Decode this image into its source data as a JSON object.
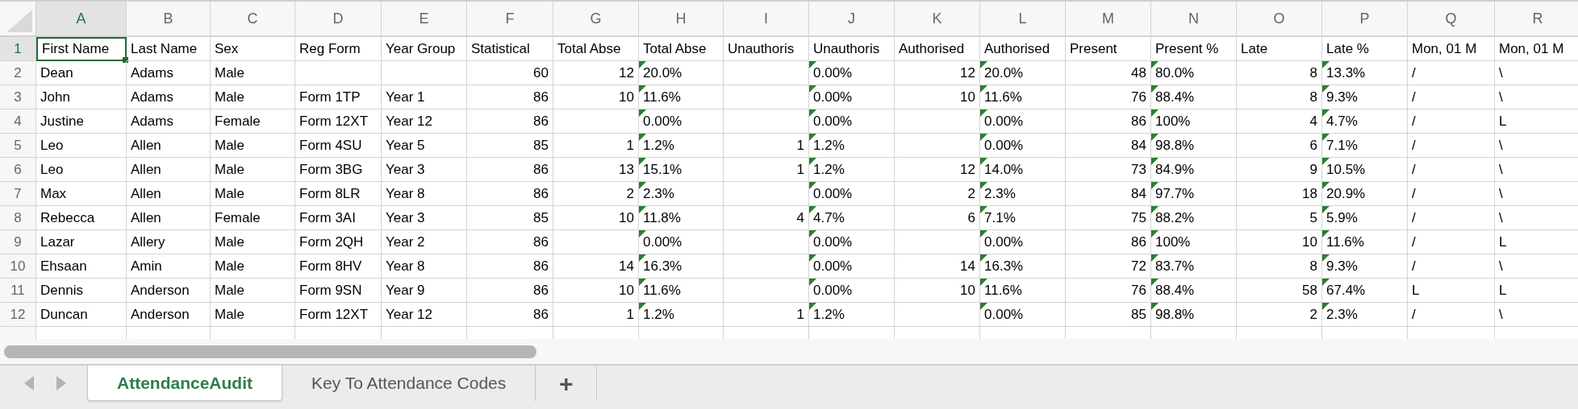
{
  "columns": [
    {
      "letter": "A",
      "kind": "text",
      "selected": true
    },
    {
      "letter": "B",
      "kind": "text",
      "selected": false
    },
    {
      "letter": "C",
      "kind": "text",
      "selected": false
    },
    {
      "letter": "D",
      "kind": "text",
      "selected": false
    },
    {
      "letter": "E",
      "kind": "text",
      "selected": false
    },
    {
      "letter": "F",
      "kind": "number",
      "selected": false
    },
    {
      "letter": "G",
      "kind": "number",
      "selected": false
    },
    {
      "letter": "H",
      "kind": "percent",
      "selected": false
    },
    {
      "letter": "I",
      "kind": "number",
      "selected": false
    },
    {
      "letter": "J",
      "kind": "percent",
      "selected": false
    },
    {
      "letter": "K",
      "kind": "number",
      "selected": false
    },
    {
      "letter": "L",
      "kind": "percent",
      "selected": false
    },
    {
      "letter": "M",
      "kind": "number",
      "selected": false
    },
    {
      "letter": "N",
      "kind": "percent",
      "selected": false
    },
    {
      "letter": "O",
      "kind": "number",
      "selected": false
    },
    {
      "letter": "P",
      "kind": "percent",
      "selected": false
    },
    {
      "letter": "Q",
      "kind": "text",
      "selected": false
    },
    {
      "letter": "R",
      "kind": "text",
      "selected": false
    }
  ],
  "rows": [
    {
      "number": "1",
      "kind": "header",
      "selected": true,
      "cells": [
        "First Name",
        "Last Name",
        "Sex",
        "Reg Form",
        "Year Group",
        "Statistical",
        "Total Abse",
        "Total Abse",
        "Unauthoris",
        "Unauthoris",
        "Authorised",
        "Authorised",
        "Present",
        "Present %",
        "Late",
        "Late %",
        "Mon, 01 M",
        "Mon, 01 M"
      ]
    },
    {
      "number": "2",
      "kind": "data",
      "selected": false,
      "cells": [
        "Dean",
        "Adams",
        "Male",
        null,
        null,
        "60",
        "12",
        "20.0%",
        null,
        "0.00%",
        "12",
        "20.0%",
        "48",
        "80.0%",
        "8",
        "13.3%",
        "/",
        "\\"
      ]
    },
    {
      "number": "3",
      "kind": "data",
      "selected": false,
      "cells": [
        "John",
        "Adams",
        "Male",
        "Form 1TP",
        "Year 1",
        "86",
        "10",
        "11.6%",
        null,
        "0.00%",
        "10",
        "11.6%",
        "76",
        "88.4%",
        "8",
        "9.3%",
        "/",
        "\\"
      ]
    },
    {
      "number": "4",
      "kind": "data",
      "selected": false,
      "cells": [
        "Justine",
        "Adams",
        "Female",
        "Form 12XT",
        "Year 12",
        "86",
        null,
        "0.00%",
        null,
        "0.00%",
        null,
        "0.00%",
        "86",
        "100%",
        "4",
        "4.7%",
        "/",
        "L"
      ]
    },
    {
      "number": "5",
      "kind": "data",
      "selected": false,
      "cells": [
        "Leo",
        "Allen",
        "Male",
        "Form 4SU",
        "Year 5",
        "85",
        "1",
        "1.2%",
        "1",
        "1.2%",
        null,
        "0.00%",
        "84",
        "98.8%",
        "6",
        "7.1%",
        "/",
        "\\"
      ]
    },
    {
      "number": "6",
      "kind": "data",
      "selected": false,
      "cells": [
        "Leo",
        "Allen",
        "Male",
        "Form 3BG",
        "Year 3",
        "86",
        "13",
        "15.1%",
        "1",
        "1.2%",
        "12",
        "14.0%",
        "73",
        "84.9%",
        "9",
        "10.5%",
        "/",
        "\\"
      ]
    },
    {
      "number": "7",
      "kind": "data",
      "selected": false,
      "cells": [
        "Max",
        "Allen",
        "Male",
        "Form 8LR",
        "Year 8",
        "86",
        "2",
        "2.3%",
        null,
        "0.00%",
        "2",
        "2.3%",
        "84",
        "97.7%",
        "18",
        "20.9%",
        "/",
        "\\"
      ]
    },
    {
      "number": "8",
      "kind": "data",
      "selected": false,
      "cells": [
        "Rebecca",
        "Allen",
        "Female",
        "Form 3AI",
        "Year 3",
        "85",
        "10",
        "11.8%",
        "4",
        "4.7%",
        "6",
        "7.1%",
        "75",
        "88.2%",
        "5",
        "5.9%",
        "/",
        "\\"
      ]
    },
    {
      "number": "9",
      "kind": "data",
      "selected": false,
      "cells": [
        "Lazar",
        "Allery",
        "Male",
        "Form 2QH",
        "Year 2",
        "86",
        null,
        "0.00%",
        null,
        "0.00%",
        null,
        "0.00%",
        "86",
        "100%",
        "10",
        "11.6%",
        "/",
        "L"
      ]
    },
    {
      "number": "10",
      "kind": "data",
      "selected": false,
      "cells": [
        "Ehsaan",
        "Amin",
        "Male",
        "Form 8HV",
        "Year 8",
        "86",
        "14",
        "16.3%",
        null,
        "0.00%",
        "14",
        "16.3%",
        "72",
        "83.7%",
        "8",
        "9.3%",
        "/",
        "\\"
      ]
    },
    {
      "number": "11",
      "kind": "data",
      "selected": false,
      "cells": [
        "Dennis",
        "Anderson",
        "Male",
        "Form 9SN",
        "Year 9",
        "86",
        "10",
        "11.6%",
        null,
        "0.00%",
        "10",
        "11.6%",
        "76",
        "88.4%",
        "58",
        "67.4%",
        "L",
        "L"
      ]
    },
    {
      "number": "12",
      "kind": "data",
      "selected": false,
      "cells": [
        "Duncan",
        "Anderson",
        "Male",
        "Form 12XT",
        "Year 12",
        "86",
        "1",
        "1.2%",
        "1",
        "1.2%",
        null,
        "0.00%",
        "85",
        "98.8%",
        "2",
        "2.3%",
        "/",
        "\\"
      ]
    }
  ],
  "sheet_tabs": [
    {
      "label": "AttendanceAudit",
      "selected": true
    },
    {
      "label": "Key To Attendance Codes",
      "selected": false
    }
  ],
  "add_sheet": "+"
}
